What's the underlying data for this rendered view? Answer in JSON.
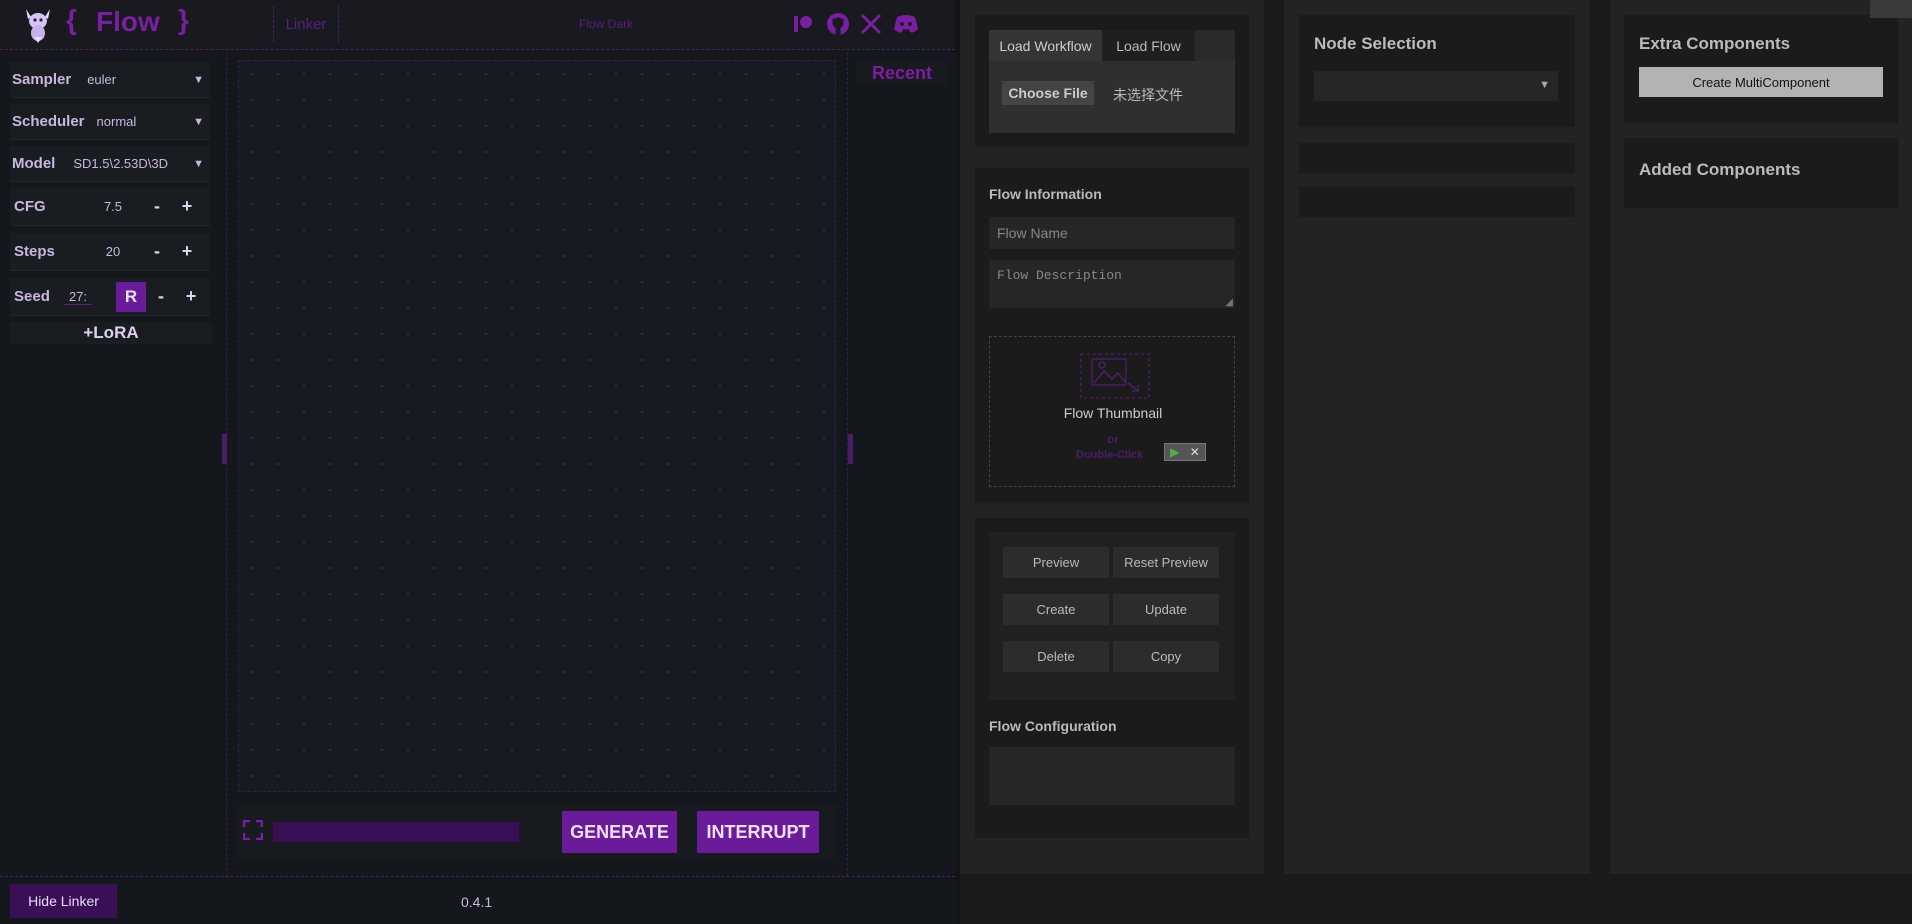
{
  "header": {
    "logo_open_brace": "{",
    "logo_title": "Flow",
    "logo_close_brace": "}",
    "nav_linker": "Linker",
    "theme_name": "Flow Dark",
    "recent_label": "Recent"
  },
  "sidebar": {
    "sampler_label": "Sampler",
    "sampler_value": "euler",
    "scheduler_label": "Scheduler",
    "scheduler_value": "normal",
    "model_label": "Model",
    "model_value": "SD1.5\\2.53D\\3D",
    "cfg_label": "CFG",
    "cfg_value": "7.5",
    "steps_label": "Steps",
    "steps_value": "20",
    "seed_label": "Seed",
    "seed_value": "27:",
    "seed_random_label": "R",
    "minus_label": "-",
    "plus_label": "+",
    "lora_label": "+LoRA"
  },
  "bottom_controls": {
    "generate_label": "GENERATE",
    "interrupt_label": "INTERRUPT"
  },
  "footer": {
    "hide_linker_label": "Hide Linker",
    "version": "0.4.1"
  },
  "workflow_panel": {
    "tabs": [
      "Load Workflow",
      "Load Flow"
    ],
    "choose_file_label": "Choose File",
    "no_file_text": "未选择文件"
  },
  "flow_info": {
    "title": "Flow Information",
    "name_placeholder": "Flow Name",
    "description_placeholder": "Flow Description",
    "thumbnail_label": "Flow Thumbnail",
    "thumbnail_hint_or": "or",
    "thumbnail_hint_dblclick": "Double-Click"
  },
  "flow_actions": {
    "preview": "Preview",
    "reset_preview": "Reset Preview",
    "create": "Create",
    "update": "Update",
    "delete": "Delete",
    "copy": "Copy",
    "config_title": "Flow Configuration"
  },
  "node_selection": {
    "title": "Node Selection"
  },
  "extra": {
    "title": "Extra Components",
    "create_multi": "Create MultiComponent",
    "added_title": "Added Components"
  },
  "colors": {
    "accent": "#6a1b9a",
    "accent_text": "#7b1fa2",
    "panel_bg": "#232323"
  }
}
